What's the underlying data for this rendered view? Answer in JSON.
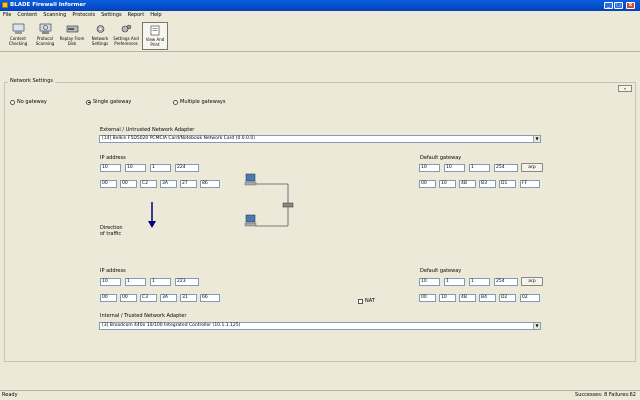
{
  "window": {
    "title": "BLADE Firewall Informer",
    "min": "_",
    "max": "□",
    "close": "x"
  },
  "menu": [
    "File",
    "Content",
    "Scanning",
    "Protocols",
    "Settings",
    "Report",
    "Help"
  ],
  "toolbar": [
    {
      "label_1": "Content",
      "label_2": "Checking",
      "icon": "content-checking-icon"
    },
    {
      "label_1": "Protocol",
      "label_2": "Scanning",
      "icon": "protocol-scanning-icon"
    },
    {
      "label_1": "Replay From",
      "label_2": "Disk",
      "icon": "replay-from-disk-icon"
    },
    {
      "label_1": "Network",
      "label_2": "Settings",
      "icon": "network-settings-icon"
    },
    {
      "label_1": "Settings And",
      "label_2": "Preferences",
      "icon": "settings-preferences-icon"
    },
    {
      "label_1": "View And",
      "label_2": "Print",
      "icon": "view-print-icon"
    }
  ],
  "network": {
    "section_title": "Network Settings",
    "collapse": "«",
    "gateway_options": [
      {
        "label": "No gateway",
        "selected": false
      },
      {
        "label": "Single gateway",
        "selected": true
      },
      {
        "label": "Multiple gateways",
        "selected": false
      }
    ],
    "external": {
      "title": "External / Untrusted Network Adapter",
      "adapter": "[14]  Belkin F5D5020 PCMCIA Card/Notebook Network Card (0.0.0.0)",
      "ip_label": "IP address",
      "ip": [
        "10",
        "10",
        "1",
        "224"
      ],
      "mac": [
        "00",
        "00",
        "C2",
        "3A",
        "27",
        "86"
      ],
      "gw_label": "Default gateway",
      "gw_ip": [
        "10",
        "10",
        "1",
        "254"
      ],
      "gw_mac": [
        "00",
        "10",
        "4B",
        "B3",
        "D1",
        "FF"
      ],
      "arp": "arp"
    },
    "direction_label_1": "Direction",
    "direction_label_2": "of traffic",
    "internal": {
      "title": "Internal / Trusted Network Adapter",
      "adapter": "[3]  Broadcom 440x 10/100 Integrated Controller (10.1.1.125)",
      "ip_label": "IP address",
      "ip": [
        "10",
        "1",
        "1",
        "223"
      ],
      "mac": [
        "00",
        "00",
        "C3",
        "3A",
        "31",
        "66"
      ],
      "gw_label": "Default gateway",
      "gw_ip": [
        "10",
        "1",
        "1",
        "254"
      ],
      "gw_mac": [
        "00",
        "10",
        "4B",
        "B4",
        "D2",
        "02"
      ],
      "arp": "arp",
      "nat_label": "NAT"
    }
  },
  "status": {
    "left": "Ready",
    "right": "Successes: 8  Failures:62"
  },
  "colors": {
    "title_bar": "#0a5fe0",
    "arrow": "#00007f"
  }
}
